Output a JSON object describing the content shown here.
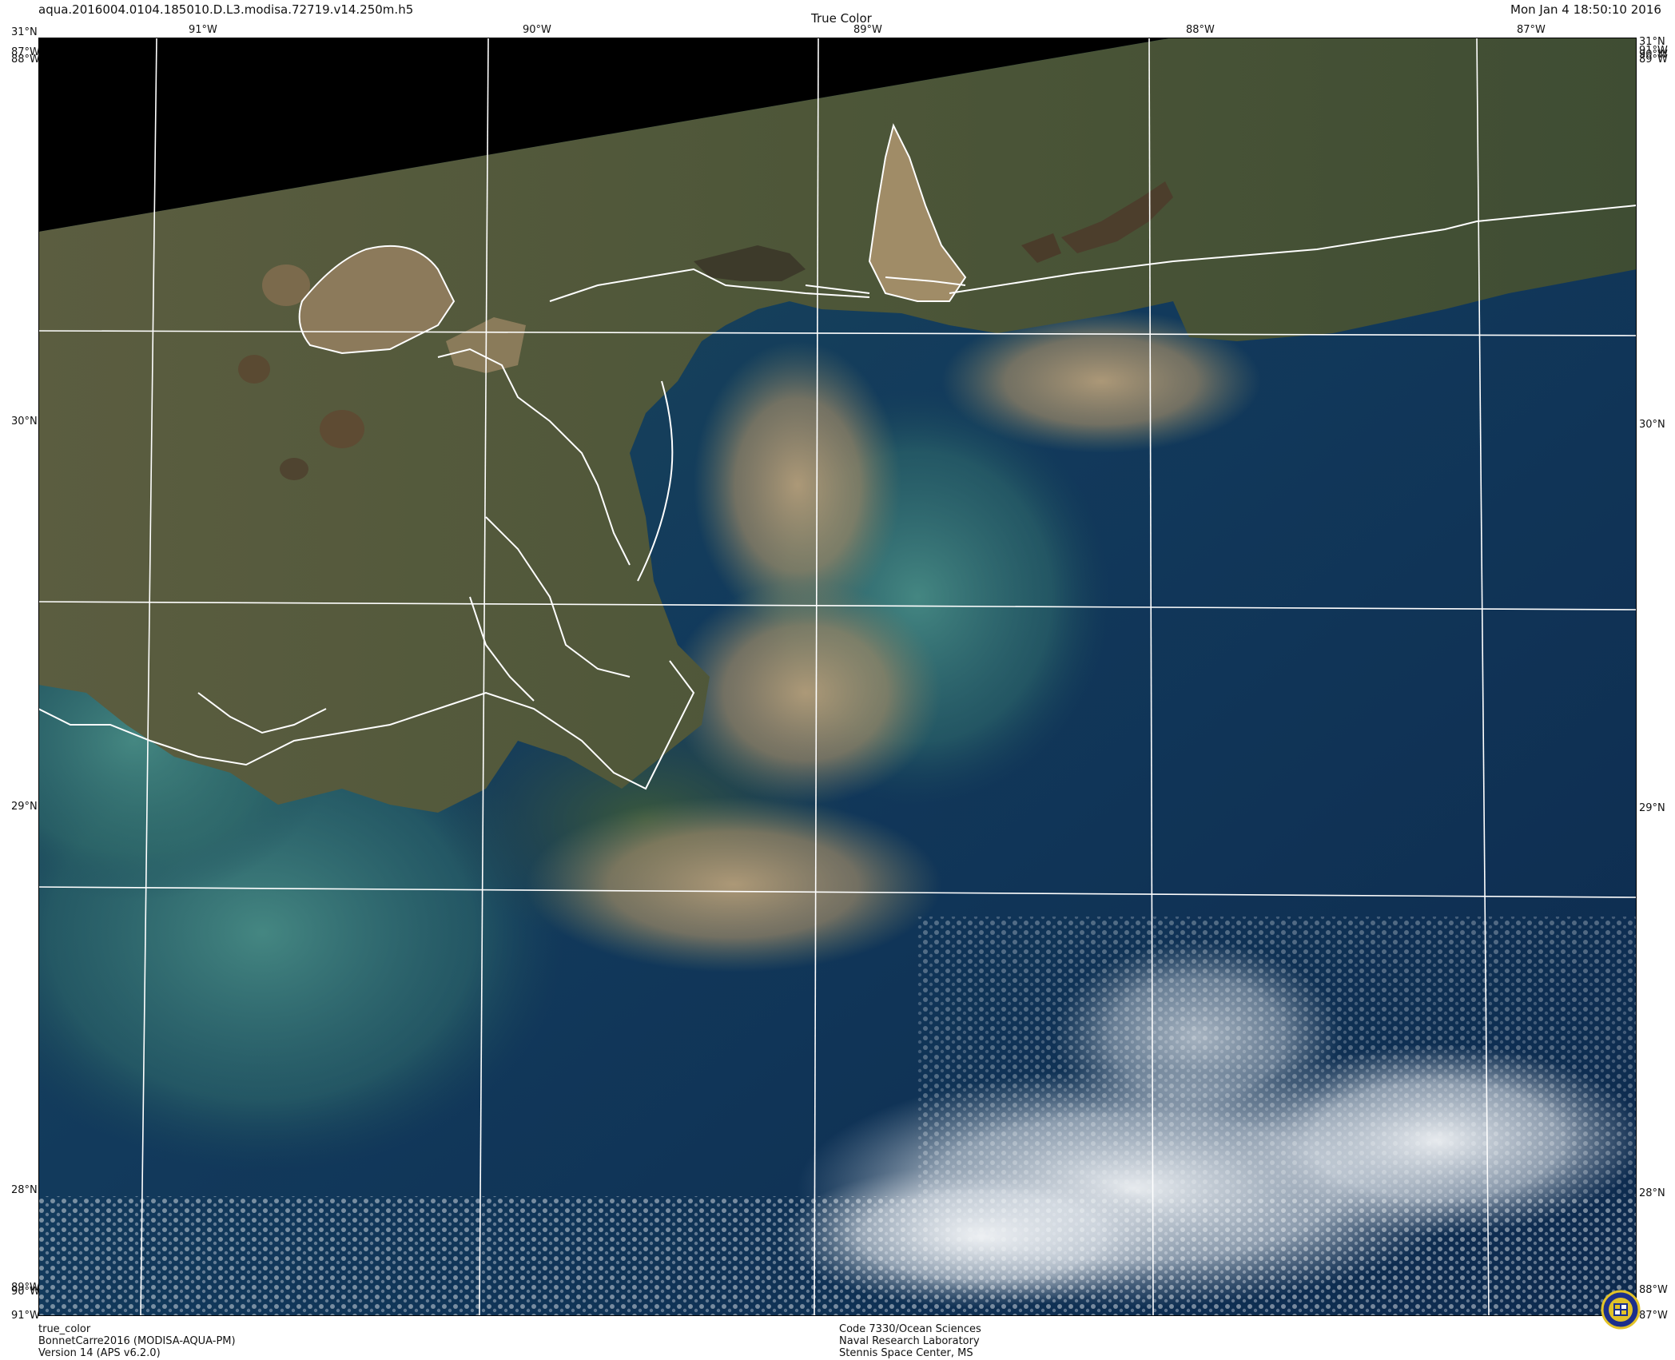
{
  "header": {
    "filename": "aqua.2016004.0104.185010.D.L3.modisa.72719.v14.250m.h5",
    "product": "True Color",
    "datetime": "Mon Jan  4 18:50:10 2016"
  },
  "top_labels": [
    "31°N",
    "91°W",
    "90°W",
    "89°W",
    "88°W",
    "87°W",
    "31°N"
  ],
  "left_labels": [
    "87°W",
    "88°W",
    "30°N",
    "29°N",
    "28°N",
    "89°W",
    "90°W",
    "91°W"
  ],
  "right_labels": [
    "91°W",
    "90°W",
    "89°W",
    "30°N",
    "29°N",
    "28°N",
    "88°W",
    "87°W"
  ],
  "footer_left": [
    "true_color",
    "BonnetCarre2016 (MODISA-AQUA-PM)",
    "Version 14 (APS v6.2.0)"
  ],
  "footer_center": [
    "Code 7330/Ocean Sciences",
    "Naval Research Laboratory",
    "Stennis Space Center, MS"
  ],
  "colors": {
    "ocean_deep": "#0d2a4e",
    "ocean_mid": "#123a5c",
    "land": "#4d5638",
    "sediment": "#a58f6c",
    "turbid": "#3f7f7a",
    "swath_mask": "#000000",
    "grid": "#ffffff",
    "coast": "#ffffff",
    "cloud": "#f2f4f6"
  }
}
